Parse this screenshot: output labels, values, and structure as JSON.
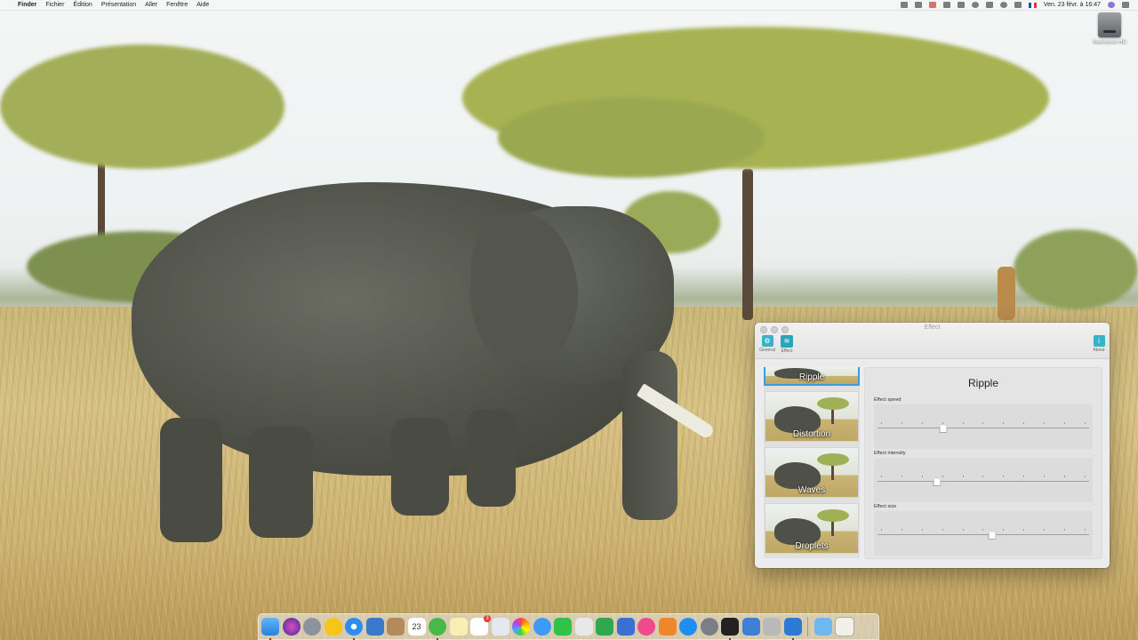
{
  "menubar": {
    "app_name": "Finder",
    "menus": [
      "Fichier",
      "Édition",
      "Présentation",
      "Aller",
      "Fenêtre",
      "Aide"
    ],
    "clock": "Ven. 23 févr. à 16:47"
  },
  "desktop": {
    "hd_label": "Macintosh HD"
  },
  "window": {
    "title": "Effect",
    "toolbar": {
      "general_label": "General",
      "effect_label": "Effect",
      "about_label": "About"
    },
    "effects": [
      "Ripple",
      "Distortion",
      "Waves",
      "Droplets"
    ],
    "selected_effect": "Ripple",
    "panel_title": "Ripple",
    "sliders": [
      {
        "label": "Effect speed",
        "value": 0.31
      },
      {
        "label": "Effect intensity",
        "value": 0.28
      },
      {
        "label": "Effect size",
        "value": 0.54
      }
    ]
  },
  "dock": {
    "calendar_day": "23",
    "reminders_badge": "3"
  }
}
